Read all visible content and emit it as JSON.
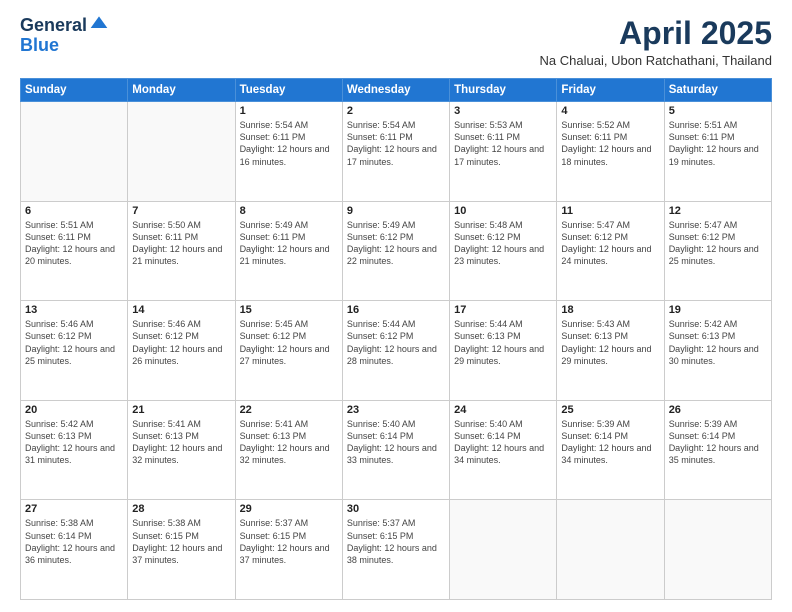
{
  "logo": {
    "general": "General",
    "blue": "Blue"
  },
  "header": {
    "month": "April 2025",
    "location": "Na Chaluai, Ubon Ratchathani, Thailand"
  },
  "days_of_week": [
    "Sunday",
    "Monday",
    "Tuesday",
    "Wednesday",
    "Thursday",
    "Friday",
    "Saturday"
  ],
  "weeks": [
    [
      {
        "day": "",
        "info": ""
      },
      {
        "day": "",
        "info": ""
      },
      {
        "day": "1",
        "info": "Sunrise: 5:54 AM\nSunset: 6:11 PM\nDaylight: 12 hours and 16 minutes."
      },
      {
        "day": "2",
        "info": "Sunrise: 5:54 AM\nSunset: 6:11 PM\nDaylight: 12 hours and 17 minutes."
      },
      {
        "day": "3",
        "info": "Sunrise: 5:53 AM\nSunset: 6:11 PM\nDaylight: 12 hours and 17 minutes."
      },
      {
        "day": "4",
        "info": "Sunrise: 5:52 AM\nSunset: 6:11 PM\nDaylight: 12 hours and 18 minutes."
      },
      {
        "day": "5",
        "info": "Sunrise: 5:51 AM\nSunset: 6:11 PM\nDaylight: 12 hours and 19 minutes."
      }
    ],
    [
      {
        "day": "6",
        "info": "Sunrise: 5:51 AM\nSunset: 6:11 PM\nDaylight: 12 hours and 20 minutes."
      },
      {
        "day": "7",
        "info": "Sunrise: 5:50 AM\nSunset: 6:11 PM\nDaylight: 12 hours and 21 minutes."
      },
      {
        "day": "8",
        "info": "Sunrise: 5:49 AM\nSunset: 6:11 PM\nDaylight: 12 hours and 21 minutes."
      },
      {
        "day": "9",
        "info": "Sunrise: 5:49 AM\nSunset: 6:12 PM\nDaylight: 12 hours and 22 minutes."
      },
      {
        "day": "10",
        "info": "Sunrise: 5:48 AM\nSunset: 6:12 PM\nDaylight: 12 hours and 23 minutes."
      },
      {
        "day": "11",
        "info": "Sunrise: 5:47 AM\nSunset: 6:12 PM\nDaylight: 12 hours and 24 minutes."
      },
      {
        "day": "12",
        "info": "Sunrise: 5:47 AM\nSunset: 6:12 PM\nDaylight: 12 hours and 25 minutes."
      }
    ],
    [
      {
        "day": "13",
        "info": "Sunrise: 5:46 AM\nSunset: 6:12 PM\nDaylight: 12 hours and 25 minutes."
      },
      {
        "day": "14",
        "info": "Sunrise: 5:46 AM\nSunset: 6:12 PM\nDaylight: 12 hours and 26 minutes."
      },
      {
        "day": "15",
        "info": "Sunrise: 5:45 AM\nSunset: 6:12 PM\nDaylight: 12 hours and 27 minutes."
      },
      {
        "day": "16",
        "info": "Sunrise: 5:44 AM\nSunset: 6:12 PM\nDaylight: 12 hours and 28 minutes."
      },
      {
        "day": "17",
        "info": "Sunrise: 5:44 AM\nSunset: 6:13 PM\nDaylight: 12 hours and 29 minutes."
      },
      {
        "day": "18",
        "info": "Sunrise: 5:43 AM\nSunset: 6:13 PM\nDaylight: 12 hours and 29 minutes."
      },
      {
        "day": "19",
        "info": "Sunrise: 5:42 AM\nSunset: 6:13 PM\nDaylight: 12 hours and 30 minutes."
      }
    ],
    [
      {
        "day": "20",
        "info": "Sunrise: 5:42 AM\nSunset: 6:13 PM\nDaylight: 12 hours and 31 minutes."
      },
      {
        "day": "21",
        "info": "Sunrise: 5:41 AM\nSunset: 6:13 PM\nDaylight: 12 hours and 32 minutes."
      },
      {
        "day": "22",
        "info": "Sunrise: 5:41 AM\nSunset: 6:13 PM\nDaylight: 12 hours and 32 minutes."
      },
      {
        "day": "23",
        "info": "Sunrise: 5:40 AM\nSunset: 6:14 PM\nDaylight: 12 hours and 33 minutes."
      },
      {
        "day": "24",
        "info": "Sunrise: 5:40 AM\nSunset: 6:14 PM\nDaylight: 12 hours and 34 minutes."
      },
      {
        "day": "25",
        "info": "Sunrise: 5:39 AM\nSunset: 6:14 PM\nDaylight: 12 hours and 34 minutes."
      },
      {
        "day": "26",
        "info": "Sunrise: 5:39 AM\nSunset: 6:14 PM\nDaylight: 12 hours and 35 minutes."
      }
    ],
    [
      {
        "day": "27",
        "info": "Sunrise: 5:38 AM\nSunset: 6:14 PM\nDaylight: 12 hours and 36 minutes."
      },
      {
        "day": "28",
        "info": "Sunrise: 5:38 AM\nSunset: 6:15 PM\nDaylight: 12 hours and 37 minutes."
      },
      {
        "day": "29",
        "info": "Sunrise: 5:37 AM\nSunset: 6:15 PM\nDaylight: 12 hours and 37 minutes."
      },
      {
        "day": "30",
        "info": "Sunrise: 5:37 AM\nSunset: 6:15 PM\nDaylight: 12 hours and 38 minutes."
      },
      {
        "day": "",
        "info": ""
      },
      {
        "day": "",
        "info": ""
      },
      {
        "day": "",
        "info": ""
      }
    ]
  ]
}
